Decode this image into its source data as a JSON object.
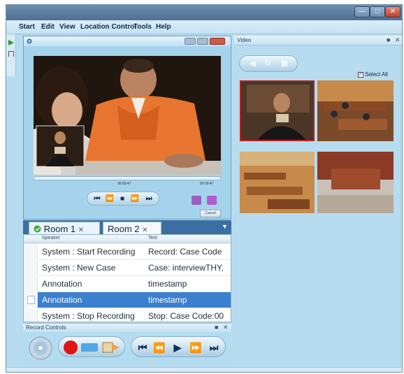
{
  "menu": {
    "items": [
      "Start",
      "Edit",
      "View",
      "Location Control",
      "Tools",
      "Help"
    ]
  },
  "window": {
    "minimize_icon": "minimize-icon",
    "maximize_icon": "maximize-icon",
    "close_icon": "close-icon"
  },
  "player": {
    "time_start": "00:00:47",
    "time_end": "00:00:47",
    "cancel_label": "Cancel",
    "transport": [
      "first-icon",
      "rewind-icon",
      "stop-icon",
      "forward-icon",
      "last-icon"
    ]
  },
  "video_panel": {
    "title": "Video",
    "select_all_label": "Select All",
    "select_all_checked": true
  },
  "tabs": [
    {
      "label": "Room 1",
      "active": true
    },
    {
      "label": "Room 2",
      "active": false
    }
  ],
  "log": {
    "columns": [
      "Speaker",
      "Text"
    ],
    "rows": [
      {
        "speaker": "System : Start Recording",
        "text": "Record: Case Code",
        "selected": false
      },
      {
        "speaker": "System : New Case",
        "text": "Case: interviewTHY,",
        "selected": false
      },
      {
        "speaker": "Annotation",
        "text": "timestamp",
        "selected": false
      },
      {
        "speaker": "Annotation",
        "text": "timestamp",
        "selected": true
      },
      {
        "speaker": "System : Stop Recording",
        "text": "Stop: Case Code:00",
        "selected": false
      }
    ]
  },
  "record_controls": {
    "title": "Record Controls",
    "buttons": [
      "disc-icon",
      "record-icon",
      "export-icon",
      "first-icon",
      "rewind-icon",
      "play-icon",
      "forward-icon",
      "last-icon"
    ]
  },
  "colors": {
    "selection": "#3b7fcf",
    "record_red": "#e01515",
    "panel_bg": "#b7dcef"
  }
}
